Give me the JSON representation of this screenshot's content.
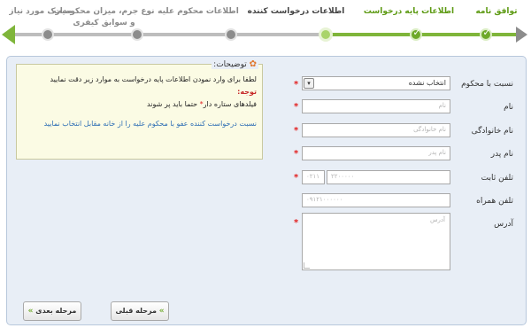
{
  "wizard": {
    "steps": [
      {
        "label": "توافق نامه",
        "status": "done"
      },
      {
        "label": "اطلاعات پایه درخواست",
        "status": "done"
      },
      {
        "label": "اطلاعات درخواست کننده",
        "status": "current"
      },
      {
        "label": "اطلاعات محکوم علیه",
        "status": "todo"
      },
      {
        "label": "نوع جرم، میزان محکومیت و سوابق کیفری",
        "status": "todo"
      },
      {
        "label": "مدارک مورد نیاز",
        "status": "todo"
      }
    ],
    "check_glyph": "✓"
  },
  "info": {
    "title": "توضیحات:",
    "line1": "لطفا برای وارد نمودن اطلاعات پایه درخواست به موارد زیر دقت نمایید",
    "warning": "توجه:",
    "line2_pre": "فیلدهای ستاره دار",
    "line2_star": "*",
    "line2_post": "حتما باید پر شوند",
    "note": "نسبت درخواست کننده عفو با محکوم علیه را از خانه مقابل انتخاب نمایید"
  },
  "form": {
    "relation": {
      "label": "نسبت با محکوم",
      "value": "انتخاب نشده"
    },
    "first_name": {
      "label": "نام",
      "placeholder": "نام"
    },
    "last_name": {
      "label": "نام خانوادگی",
      "placeholder": "نام خانوادگی"
    },
    "father_name": {
      "label": "نام پدر",
      "placeholder": "نام پدر"
    },
    "landline": {
      "label": "تلفن ثابت",
      "area_placeholder": "۰۲۱۱",
      "number_placeholder": "۲۲۰۰۰۰۰"
    },
    "mobile": {
      "label": "تلفن همراه",
      "placeholder": "۰۹۱۲۱۰۰۰۰۰۰"
    },
    "address": {
      "label": "آدرس",
      "placeholder": "آدرس"
    },
    "required_mark": "*"
  },
  "buttons": {
    "prev": {
      "label": "مرحله قبلی",
      "chevron": "»"
    },
    "next": {
      "label": "مرحله بعدی",
      "chevron": "»"
    }
  },
  "colors": {
    "accent_green": "#7fb53a",
    "required_red": "#e21f1f",
    "panel_bg": "#e8eef6"
  }
}
